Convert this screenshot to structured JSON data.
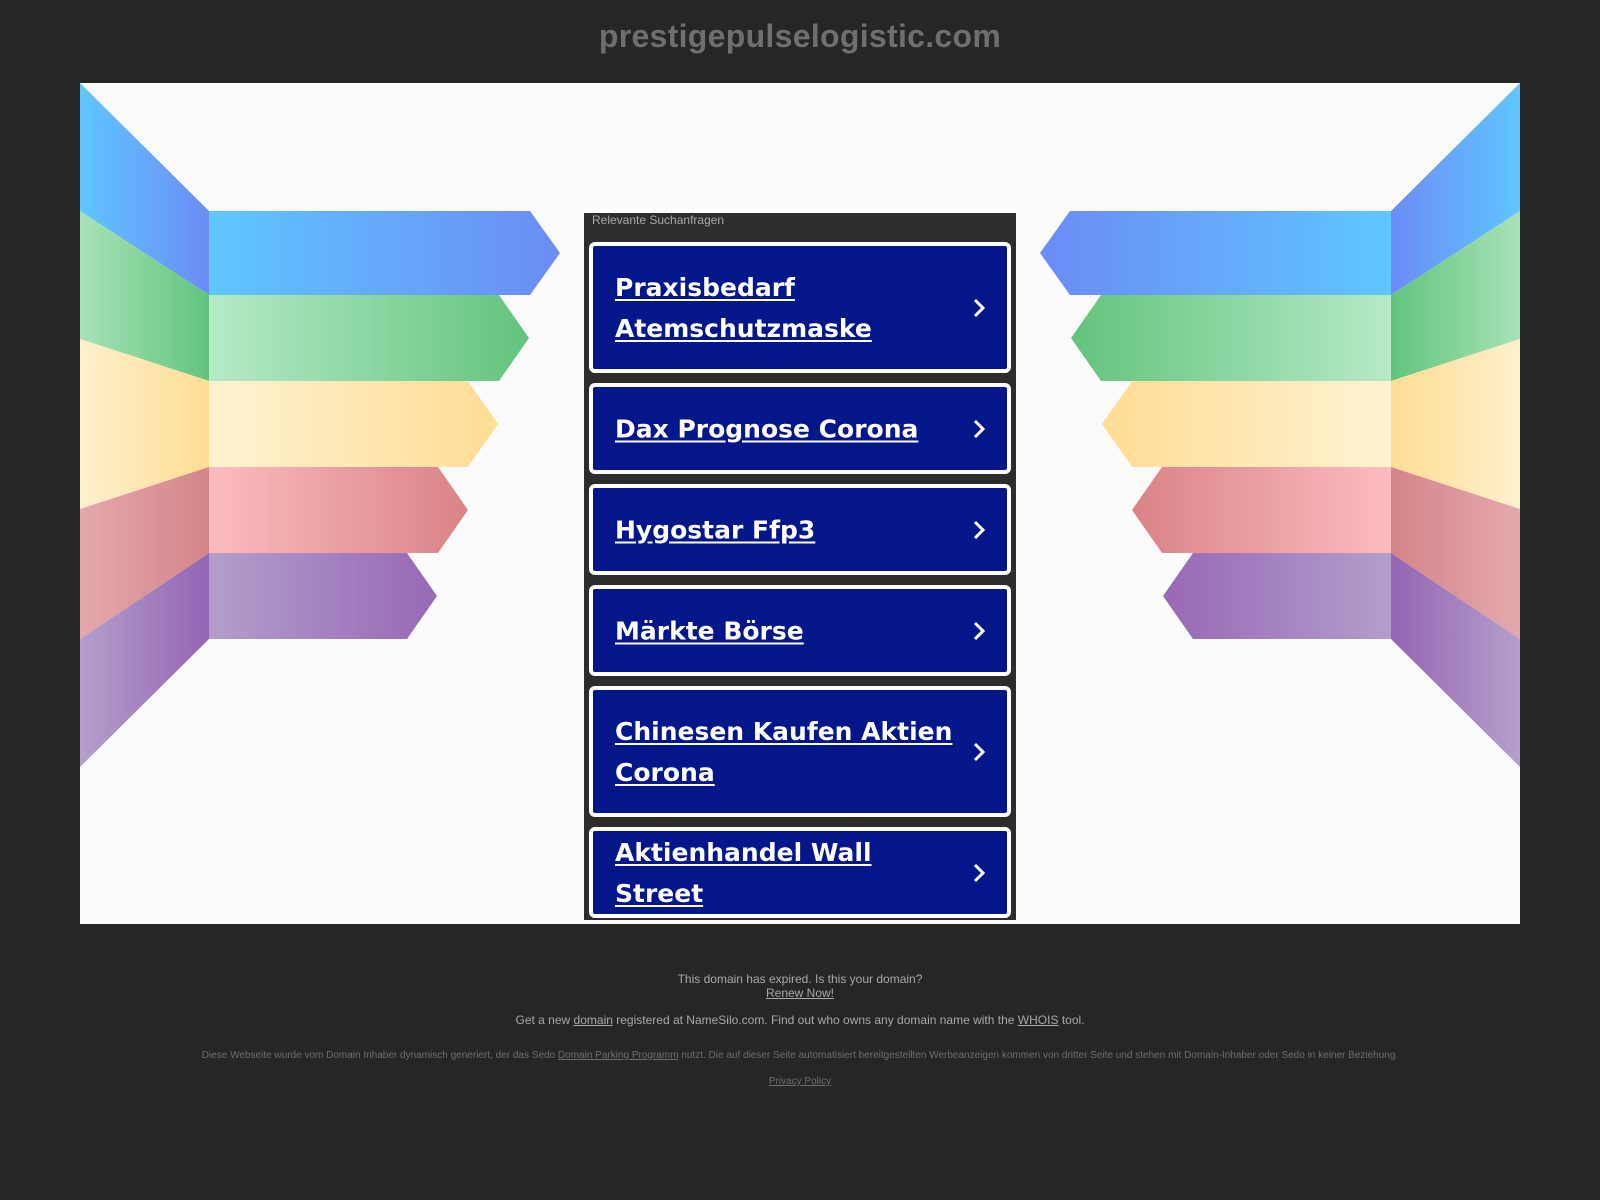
{
  "header": {
    "domain_title": "prestigepulselogistic.com"
  },
  "panel": {
    "heading": "Relevante Suchanfragen",
    "links": [
      {
        "label": "Praxisbedarf Atemschutzmaske"
      },
      {
        "label": "Dax Prognose Corona"
      },
      {
        "label": "Hygostar Ffp3"
      },
      {
        "label": "Märkte Börse"
      },
      {
        "label": "Chinesen Kaufen Aktien Corona"
      },
      {
        "label": "Aktienhandel Wall Street"
      }
    ]
  },
  "footer": {
    "expired_text": "This domain has expired. Is this your domain?",
    "renew_link": "Renew Now!",
    "get_new_prefix": "Get a new",
    "domain_link": "domain",
    "get_new_middle": "registered at NameSilo.com. Find out who owns any domain name with the",
    "whois_link": "WHOIS",
    "get_new_suffix": "tool.",
    "disclaimer_prefix": "Diese Webseite wurde vom Domain Inhaber dynamisch generiert, der das Sedo",
    "parking_link": "Domain Parking Programm",
    "disclaimer_suffix": "nutzt. Die auf dieser Seite automatisiert bereitgestellten Werbeanzeigen kommen von dritter Seite und stehen mit Domain-Inhaber oder Sedo in keiner Beziehung.",
    "privacy_link": "Privacy Policy"
  },
  "colors": {
    "background": "#262626",
    "stage": "#fbfbfb",
    "link_box": "#03168a",
    "panel": "#2d2d2d",
    "title": "#6f6f6f"
  },
  "icons": {
    "link_chevron": "chevron-right-icon"
  }
}
